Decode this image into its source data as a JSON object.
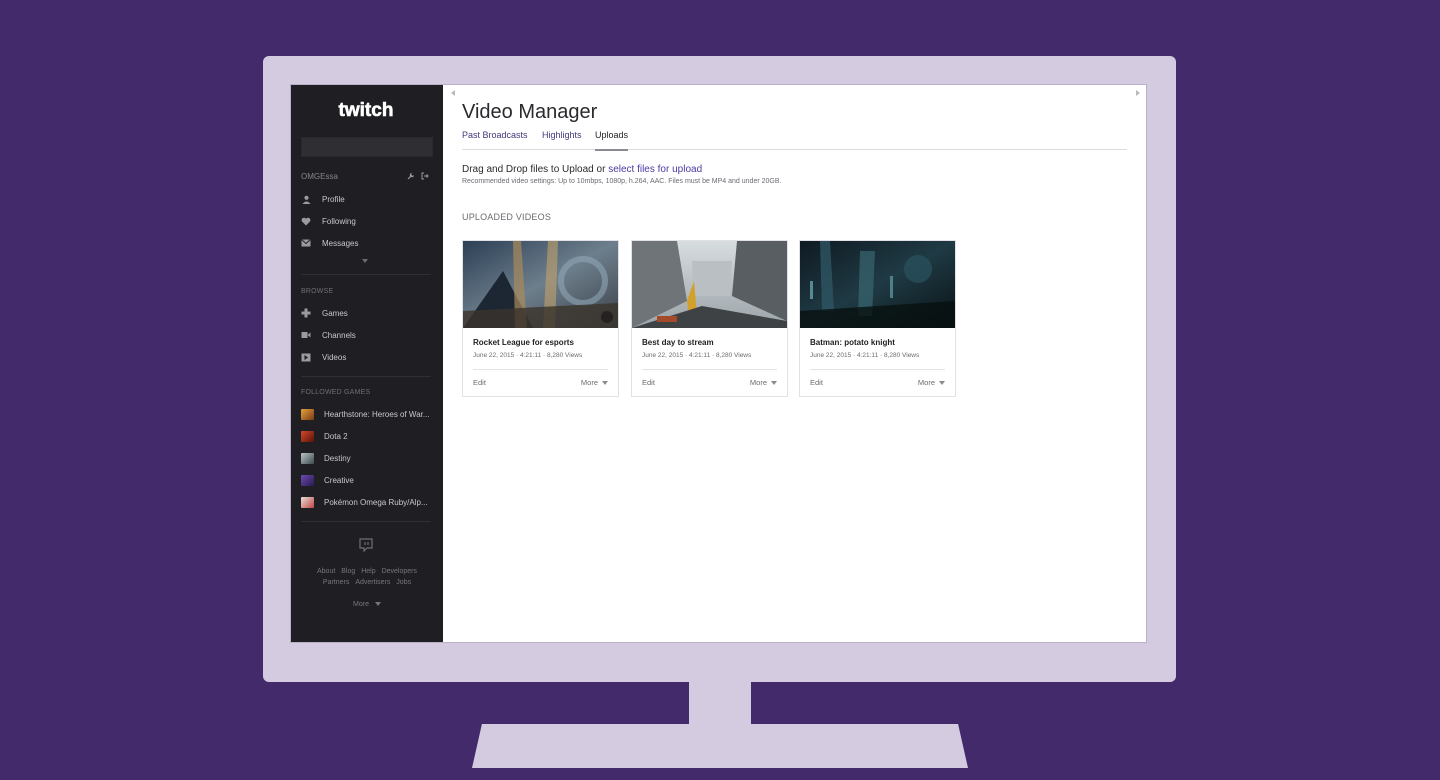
{
  "colors": {
    "background": "#422a6b",
    "bezel": "#d4cbe0",
    "sidebar": "#1f1f23",
    "link": "#4b3aa3"
  },
  "sidebar": {
    "logo": "twitch",
    "username": "OMGEssa",
    "nav_items": [
      {
        "label": "Profile",
        "icon": "user-icon"
      },
      {
        "label": "Following",
        "icon": "heart-icon"
      },
      {
        "label": "Messages",
        "icon": "envelope-icon"
      }
    ],
    "browse_label": "BROWSE",
    "browse_items": [
      {
        "label": "Games",
        "icon": "gamepad-icon"
      },
      {
        "label": "Channels",
        "icon": "video-camera-icon"
      },
      {
        "label": "Videos",
        "icon": "play-icon"
      }
    ],
    "followed_label": "FOLLOWED GAMES",
    "followed_games": [
      {
        "label": "Hearthstone: Heroes of War...",
        "color": "#b8742c"
      },
      {
        "label": "Dota 2",
        "color": "#a0301f"
      },
      {
        "label": "Destiny",
        "color": "#7a8a8e"
      },
      {
        "label": "Creative",
        "color": "#4b2f7e"
      },
      {
        "label": "Pokémon Omega Ruby/Alp...",
        "color": "#c04545"
      }
    ],
    "footer_row1": [
      "About",
      "Blog",
      "Help",
      "Developers"
    ],
    "footer_row2": [
      "Partners",
      "Advertisers",
      "Jobs"
    ],
    "footer_more": "More"
  },
  "main": {
    "title": "Video Manager",
    "tabs": [
      {
        "label": "Past Broadcasts"
      },
      {
        "label": "Highlights"
      },
      {
        "label": "Uploads",
        "active": true
      }
    ],
    "upload_text": "Drag and Drop files to Upload or ",
    "upload_link": "select files for upload",
    "upload_hint": "Recommended video settings: Up to 10mbps, 1080p, h.264, AAC. Files must be MP4 and under 20GB.",
    "uploaded_label": "UPLOADED VIDEOS",
    "videos": [
      {
        "title": "Rocket League for esports",
        "meta": "June 22, 2015 · 4:21:11 · 8,280 Views",
        "edit": "Edit",
        "more": "More"
      },
      {
        "title": "Best day to stream",
        "meta": "June 22, 2015 · 4:21:11 · 8,280 Views",
        "edit": "Edit",
        "more": "More"
      },
      {
        "title": "Batman: potato knight",
        "meta": "June 22, 2015 · 4:21:11 · 8,280 Views",
        "edit": "Edit",
        "more": "More"
      }
    ]
  }
}
